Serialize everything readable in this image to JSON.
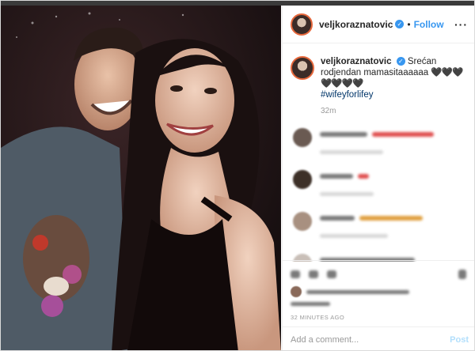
{
  "post": {
    "username": "veljkoraznatovic",
    "follow_label": "Follow",
    "more_icon": "ellipsis-icon"
  },
  "caption": {
    "username": "veljkoraznatovic",
    "text": "Srećan rodjendan mamasitaaaaaa",
    "hearts": "🖤🖤🖤🖤🖤🖤🖤",
    "hashtag": "#wifeyforlifey",
    "time": "32m"
  },
  "post_age": "32 MINUTES AGO",
  "comment_box": {
    "placeholder": "Add a comment...",
    "post_label": "Post"
  },
  "colors": {
    "link": "#3897f0",
    "hashtag": "#003569",
    "muted": "#999999"
  }
}
